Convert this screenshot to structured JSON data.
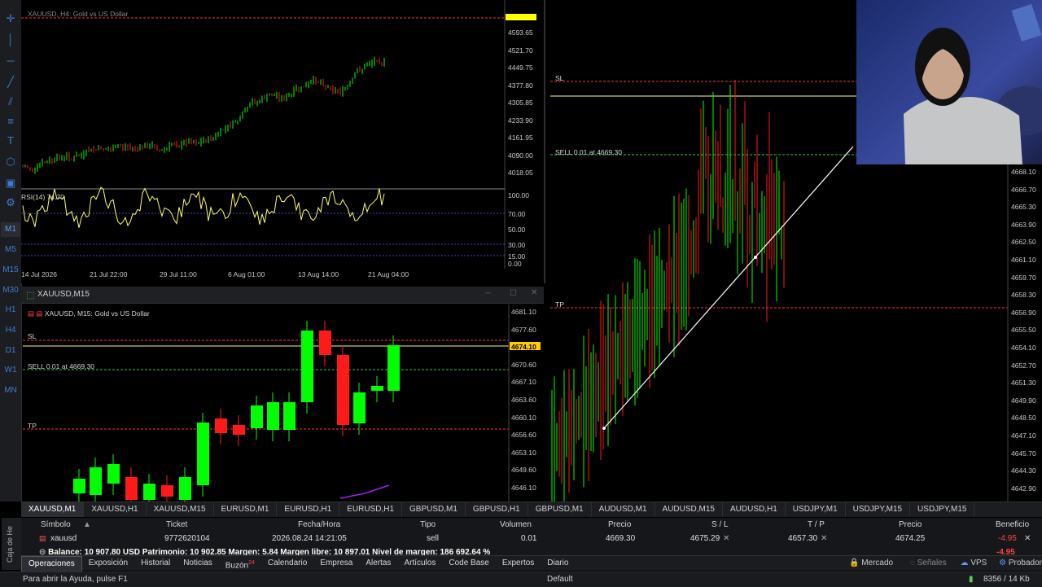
{
  "left_toolbar": {
    "tools": [
      "crosshair-icon",
      "vertical-line-icon",
      "horizontal-line-icon",
      "trendline-icon",
      "channel-icon",
      "fibonacci-icon",
      "text-icon",
      "shapes-icon",
      "rectangle-icon",
      "gann-icon"
    ],
    "timeframes": [
      "M1",
      "M5",
      "M15",
      "M30",
      "H1",
      "H4",
      "D1",
      "W1",
      "MN"
    ],
    "active_timeframe": "M1"
  },
  "chart_top_left": {
    "title": "XAUUSD, H4: Gold vs US Dollar",
    "price_ticks": [
      "4593.65",
      "4521.70",
      "4449.75",
      "4377.80",
      "4305.85",
      "4233.90",
      "4161.95",
      "4090.00",
      "4018.05"
    ],
    "rsi_label": "RSI(14) 74.70",
    "rsi_ticks": [
      "100.00",
      "70.00",
      "50.00",
      "30.00",
      "15.00",
      "0.00"
    ],
    "date_ticks": [
      "14 Jul 2026",
      "21 Jul 22:00",
      "29 Jul 11:00",
      "6 Aug 01:00",
      "13 Aug 14:00",
      "21 Aug 04:00"
    ]
  },
  "chart_bottom_left": {
    "window_title": "XAUUSD,M15",
    "title": "XAUUSD, M15: Gold vs US Dollar",
    "sl_label": "SL",
    "sell_label": "SELL 0.01 at 4669.30",
    "tp_label": "TP",
    "current_price": "4674.10",
    "price_ticks": [
      "4681.10",
      "4677.60",
      "4674.10",
      "4670.60",
      "4667.10",
      "4663.60",
      "4660.10",
      "4656.60",
      "4653.10",
      "4649.60",
      "4646.10"
    ]
  },
  "chart_right": {
    "sl_label": "SL",
    "sell_label": "SELL 0.01 at 4669.30",
    "tp_label": "TP",
    "price_ticks": [
      "4668.10",
      "4666.70",
      "4665.30",
      "4663.90",
      "4662.50",
      "4661.10",
      "4659.70",
      "4658.30",
      "4656.90",
      "4655.50",
      "4654.10",
      "4652.70",
      "4651.30",
      "4649.90",
      "4648.50",
      "4647.10",
      "4645.70",
      "4644.30",
      "4642.90"
    ]
  },
  "symbol_tabs": [
    "XAUUSD,M1",
    "XAUUSD,H1",
    "XAUUSD,M15",
    "EURUSD,M1",
    "EURUSD,H1",
    "EURUSD,H1",
    "GBPUSD,M1",
    "GBPUSD,H1",
    "GBPUSD,M1",
    "AUDUSD,M1",
    "AUDUSD,M15",
    "AUDUSD,H1",
    "USDJPY,M1",
    "USDJPY,M15",
    "USDJPY,M15"
  ],
  "active_symbol_tab": 0,
  "toolbox": {
    "side_label": "Caja de He",
    "headers": {
      "symbol": "Símbolo",
      "ticket": "Ticket",
      "datetime": "Fecha/Hora",
      "type": "Tipo",
      "volume": "Volumen",
      "price": "Precio",
      "sl": "S / L",
      "tp": "T / P",
      "current": "Precio",
      "profit": "Beneficio"
    },
    "row": {
      "symbol": "xauusd",
      "ticket": "9772620104",
      "datetime": "2026.08.24 14:21:05",
      "type": "sell",
      "volume": "0.01",
      "price": "4669.30",
      "sl": "4675.29",
      "tp": "4657.30",
      "current": "4674.25",
      "profit": "-4.95"
    },
    "balance_line": "Balance: 10 907.80 USD  Patrimonio: 10 902.85  Margen: 5.84  Margen libre: 10 897.01  Nivel de margen: 186 692.64 %",
    "balance_profit": "-4.95"
  },
  "bottom_tabs": [
    "Operaciones",
    "Exposición",
    "Historial",
    "Noticias",
    "Buzón",
    "Calendario",
    "Empresa",
    "Alertas",
    "Artículos",
    "Code Base",
    "Expertos",
    "Diario"
  ],
  "buzon_badge": "24",
  "bottom_right": {
    "market": "Mercado",
    "signals": "Señales",
    "vps": "VPS",
    "tester": "Probador"
  },
  "statusbar": {
    "help": "Para abrir la Ayuda, pulse F1",
    "profile": "Default",
    "traffic": "8356 / 14 Kb"
  },
  "colors": {
    "bull": "#00ff00",
    "bear": "#ff1a1a",
    "sl_line": "#ffff66",
    "level_red": "#ff3333",
    "sell_line": "#2ecc40",
    "accent": "#3d7ad6",
    "rsi": "#ffff66"
  }
}
